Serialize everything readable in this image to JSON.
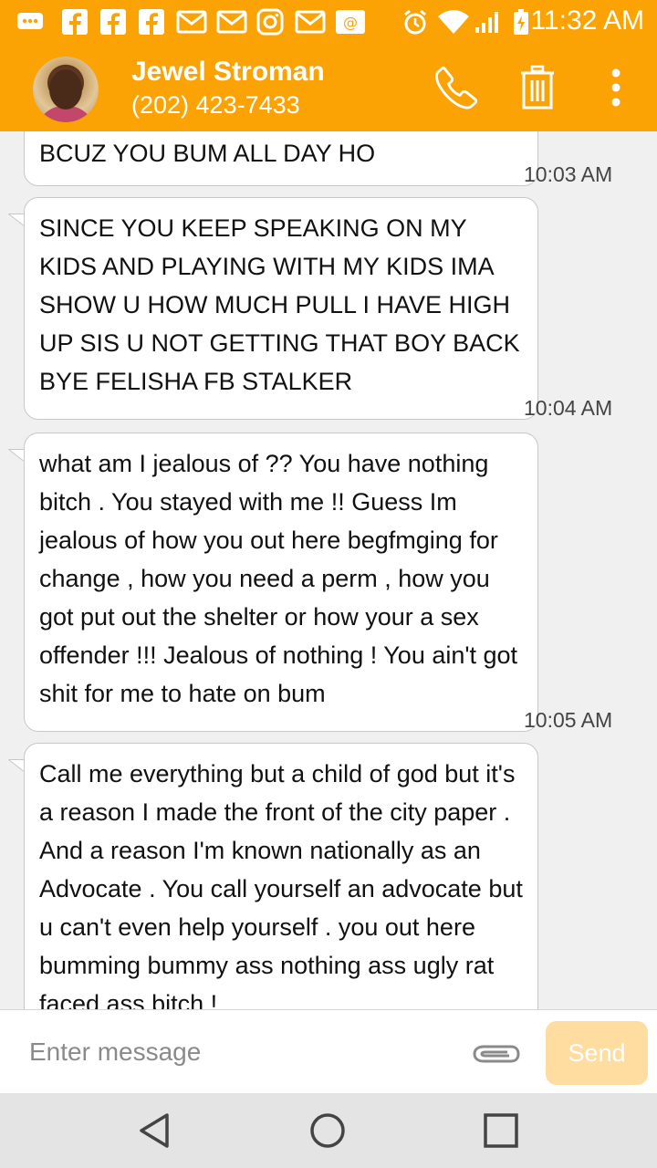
{
  "status_bar": {
    "time": "11:32 AM",
    "notification_icons": [
      "chat-bubble-icon",
      "facebook-icon",
      "facebook-icon",
      "facebook-icon",
      "gmail-icon",
      "gmail-icon",
      "instagram-icon",
      "gmail-icon",
      "email-icon"
    ],
    "system_icons": [
      "alarm-icon",
      "wifi-icon",
      "signal-icon",
      "battery-icon"
    ]
  },
  "header": {
    "contact_name": "Jewel Stroman",
    "contact_phone": "(202) 423-7433",
    "background_color": "#fba305"
  },
  "messages": [
    {
      "text": "BCUZ YOU BUM ALL DAY HO",
      "time": "10:03 AM"
    },
    {
      "text": "SINCE YOU KEEP SPEAKING ON MY KIDS AND PLAYING WITH MY KIDS IMA SHOW U HOW MUCH PULL I HAVE HIGH UP SIS U NOT GETTING THAT BOY BACK BYE FELISHA FB STALKER",
      "time": "10:04 AM"
    },
    {
      "text": "what am I jealous of ?? You have nothing bitch . You stayed with me !! Guess Im jealous of how you out here begfmging for change , how you need a perm , how you got put out the shelter or how your a sex offender !!! Jealous of nothing ! You ain't got shit for me to hate on bum",
      "time": "10:05 AM"
    },
    {
      "text": "Call me everything but a child of god but it's a reason I made the front of the city paper . And a reason I'm known nationally as an Advocate . You call yourself an advocate but u can't even help yourself . you out here bumming bummy ass nothing ass ugly rat faced ass bitch !",
      "time": ""
    }
  ],
  "composer": {
    "placeholder": "Enter message",
    "send_label": "Send"
  },
  "navbar": {
    "items": [
      "back-icon",
      "home-icon",
      "recents-icon"
    ]
  }
}
